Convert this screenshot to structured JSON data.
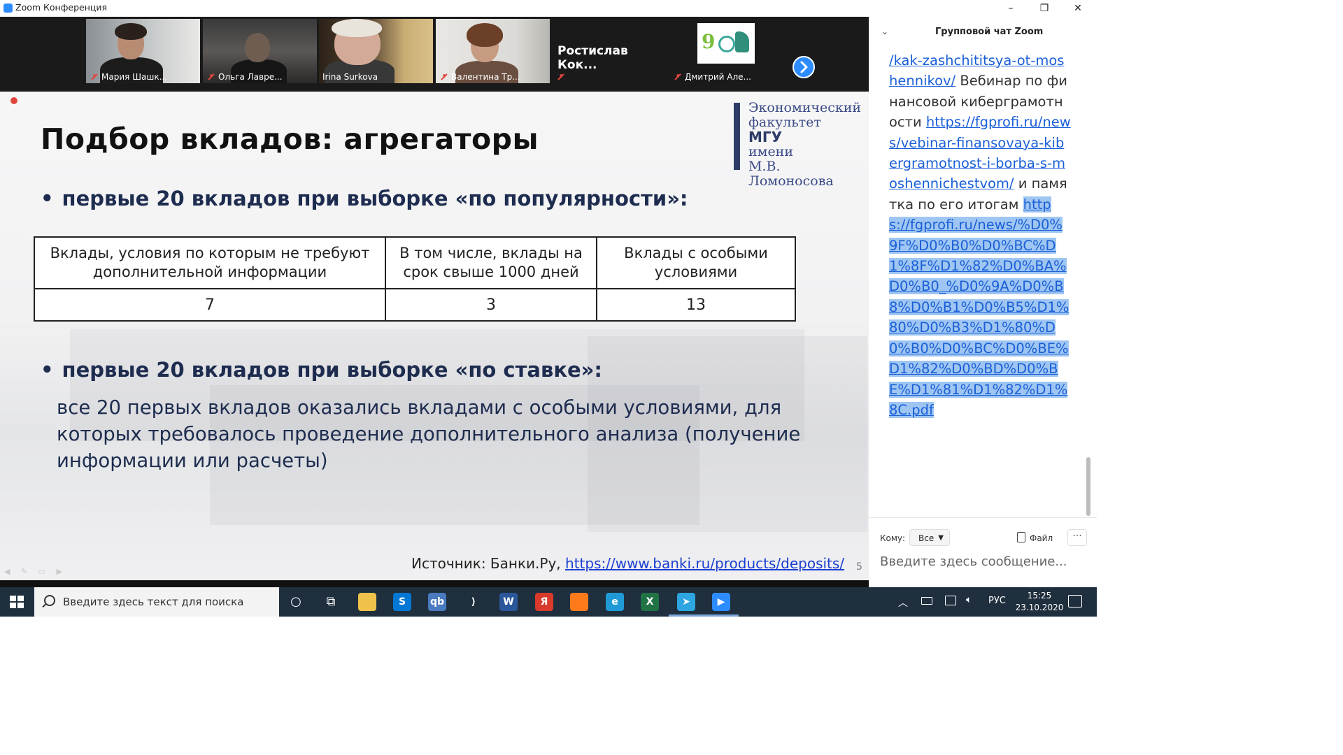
{
  "window": {
    "title": "Zoom Конференция",
    "controls": [
      "–",
      "❐",
      "✕"
    ]
  },
  "gallery": {
    "participants": [
      {
        "name": "Мария Шашк...",
        "muted": true
      },
      {
        "name": "Ольга Лавре...",
        "muted": true
      },
      {
        "name": "Irina Surkova",
        "muted": false,
        "active": true
      },
      {
        "name": "Валентина Тр...",
        "muted": true
      },
      {
        "name": "Ростислав Кок...",
        "muted": true,
        "video": false
      },
      {
        "name": "Дмитрий Але...",
        "muted": true
      }
    ],
    "next_icon": "chevron-right-icon"
  },
  "slide": {
    "title": "Подбор вкладов: агрегаторы",
    "logo": {
      "line1": "Экономический",
      "line2": "факультет",
      "line3": "МГУ",
      "line4": "имени",
      "line5": "М.В. Ломоносова"
    },
    "bullet1": "первые 20 вкладов при выборке «по популярности»:",
    "table": {
      "headers": [
        "Вклады, условия по которым не требуют дополнительной информации",
        "В том числе, вклады на срок свыше 1000 дней",
        "Вклады с особыми условиями"
      ],
      "values": [
        "7",
        "3",
        "13"
      ]
    },
    "bullet2": "первые 20 вкладов при выборке «по ставке»:",
    "body": "все 20 первых вкладов оказались вкладами с особыми условиями, для которых требовалось проведение дополнительного анализа (получение информации или расчеты)",
    "source_label": "Источник: Банки.Ру,",
    "source_link": "https://www.banki.ru/products/deposits/",
    "page_number": "5"
  },
  "chat": {
    "title": "Групповой чат Zoom",
    "messages": {
      "link1": "/kak-zashchititsya-ot-moshennikov/",
      "text1": " Вебинар по финансовой киберграмотности ",
      "link2": "https://fgprofi.ru/news/vebinar-finansovaya-kibergramotnost-i-borba-s-moshennichestvom/",
      "text2": " и памятка по его итогам ",
      "link3": "https://fgprofi.ru/news/%D0%9F%D0%B0%D0%BC%D1%8F%D1%82%D0%BA%D0%B0_%D0%9A%D0%B8%D0%B1%D0%B5%D1%80%D0%B3%D1%80%D0%B0%D0%BC%D0%BE%D1%82%D0%BD%D0%BE%D1%81%D1%82%D1%8C.pdf"
    },
    "to_label": "Кому:",
    "to_value": "Все",
    "file_label": "Файл",
    "more_label": "···",
    "input_placeholder": "Введите здесь сообщение..."
  },
  "taskbar": {
    "search_placeholder": "Введите здесь текст для поиска",
    "apps": [
      {
        "name": "cortana-icon",
        "label": "○",
        "color": "#1f2f3e"
      },
      {
        "name": "task-view-icon",
        "label": "⧉",
        "color": "#1f2f3e"
      },
      {
        "name": "file-explorer-icon",
        "label": "",
        "color": "#f0c24b"
      },
      {
        "name": "skype-icon",
        "label": "S",
        "color": "#0078d4"
      },
      {
        "name": "qbittorrent-icon",
        "label": "qb",
        "color": "#4a7bc1"
      },
      {
        "name": "vscode-icon",
        "label": "⟩",
        "color": "#1f2f3e"
      },
      {
        "name": "word-icon",
        "label": "W",
        "color": "#2b579a"
      },
      {
        "name": "yandex-icon",
        "label": "Я",
        "color": "#d93a2b"
      },
      {
        "name": "firefox-icon",
        "label": "",
        "color": "#ff7a1a"
      },
      {
        "name": "edge-icon",
        "label": "e",
        "color": "#1f9ad6"
      },
      {
        "name": "excel-icon",
        "label": "X",
        "color": "#217346"
      },
      {
        "name": "telegram-icon",
        "label": "➤",
        "color": "#2ca5e0"
      },
      {
        "name": "zoom-icon",
        "label": "▶",
        "color": "#2d8cff"
      }
    ],
    "language": "РУС",
    "time": "15:25",
    "date": "23.10.2020"
  }
}
